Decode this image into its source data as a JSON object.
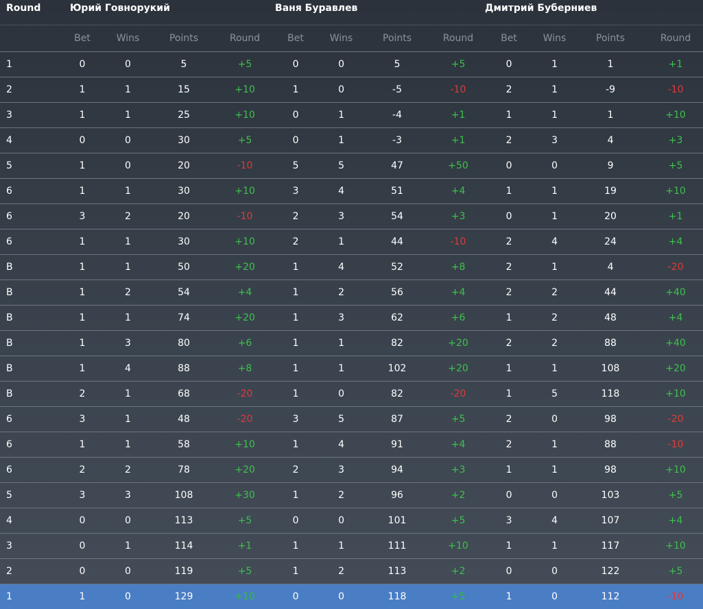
{
  "header": {
    "round_label": "Round",
    "players": [
      "Юрий Говнорукий",
      "Ваня Буравлев",
      "Дмитрий Буберниев"
    ],
    "subcolumns": [
      "Bet",
      "Wins",
      "Points",
      "Round"
    ]
  },
  "rows": [
    {
      "r": "1",
      "c": [
        [
          "0",
          "0",
          "5",
          "+5"
        ],
        [
          "0",
          "0",
          "5",
          "+5"
        ],
        [
          "0",
          "1",
          "1",
          "+1"
        ]
      ]
    },
    {
      "r": "2",
      "c": [
        [
          "1",
          "1",
          "15",
          "+10"
        ],
        [
          "1",
          "0",
          "-5",
          "-10"
        ],
        [
          "2",
          "1",
          "-9",
          "-10"
        ]
      ]
    },
    {
      "r": "3",
      "c": [
        [
          "1",
          "1",
          "25",
          "+10"
        ],
        [
          "0",
          "1",
          "-4",
          "+1"
        ],
        [
          "1",
          "1",
          "1",
          "+10"
        ]
      ]
    },
    {
      "r": "4",
      "c": [
        [
          "0",
          "0",
          "30",
          "+5"
        ],
        [
          "0",
          "1",
          "-3",
          "+1"
        ],
        [
          "2",
          "3",
          "4",
          "+3"
        ]
      ]
    },
    {
      "r": "5",
      "c": [
        [
          "1",
          "0",
          "20",
          "-10"
        ],
        [
          "5",
          "5",
          "47",
          "+50"
        ],
        [
          "0",
          "0",
          "9",
          "+5"
        ]
      ]
    },
    {
      "r": "6",
      "c": [
        [
          "1",
          "1",
          "30",
          "+10"
        ],
        [
          "3",
          "4",
          "51",
          "+4"
        ],
        [
          "1",
          "1",
          "19",
          "+10"
        ]
      ]
    },
    {
      "r": "6",
      "c": [
        [
          "3",
          "2",
          "20",
          "-10"
        ],
        [
          "2",
          "3",
          "54",
          "+3"
        ],
        [
          "0",
          "1",
          "20",
          "+1"
        ]
      ]
    },
    {
      "r": "6",
      "c": [
        [
          "1",
          "1",
          "30",
          "+10"
        ],
        [
          "2",
          "1",
          "44",
          "-10"
        ],
        [
          "2",
          "4",
          "24",
          "+4"
        ]
      ]
    },
    {
      "r": "B",
      "c": [
        [
          "1",
          "1",
          "50",
          "+20"
        ],
        [
          "1",
          "4",
          "52",
          "+8"
        ],
        [
          "2",
          "1",
          "4",
          "-20"
        ]
      ]
    },
    {
      "r": "B",
      "c": [
        [
          "1",
          "2",
          "54",
          "+4"
        ],
        [
          "1",
          "2",
          "56",
          "+4"
        ],
        [
          "2",
          "2",
          "44",
          "+40"
        ]
      ]
    },
    {
      "r": "B",
      "c": [
        [
          "1",
          "1",
          "74",
          "+20"
        ],
        [
          "1",
          "3",
          "62",
          "+6"
        ],
        [
          "1",
          "2",
          "48",
          "+4"
        ]
      ]
    },
    {
      "r": "B",
      "c": [
        [
          "1",
          "3",
          "80",
          "+6"
        ],
        [
          "1",
          "1",
          "82",
          "+20"
        ],
        [
          "2",
          "2",
          "88",
          "+40"
        ]
      ]
    },
    {
      "r": "B",
      "c": [
        [
          "1",
          "4",
          "88",
          "+8"
        ],
        [
          "1",
          "1",
          "102",
          "+20"
        ],
        [
          "1",
          "1",
          "108",
          "+20"
        ]
      ]
    },
    {
      "r": "B",
      "c": [
        [
          "2",
          "1",
          "68",
          "-20"
        ],
        [
          "1",
          "0",
          "82",
          "-20"
        ],
        [
          "1",
          "5",
          "118",
          "+10"
        ]
      ]
    },
    {
      "r": "6",
      "c": [
        [
          "3",
          "1",
          "48",
          "-20"
        ],
        [
          "3",
          "5",
          "87",
          "+5"
        ],
        [
          "2",
          "0",
          "98",
          "-20"
        ]
      ]
    },
    {
      "r": "6",
      "c": [
        [
          "1",
          "1",
          "58",
          "+10"
        ],
        [
          "1",
          "4",
          "91",
          "+4"
        ],
        [
          "2",
          "1",
          "88",
          "-10"
        ]
      ]
    },
    {
      "r": "6",
      "c": [
        [
          "2",
          "2",
          "78",
          "+20"
        ],
        [
          "2",
          "3",
          "94",
          "+3"
        ],
        [
          "1",
          "1",
          "98",
          "+10"
        ]
      ]
    },
    {
      "r": "5",
      "c": [
        [
          "3",
          "3",
          "108",
          "+30"
        ],
        [
          "1",
          "2",
          "96",
          "+2"
        ],
        [
          "0",
          "0",
          "103",
          "+5"
        ]
      ]
    },
    {
      "r": "4",
      "c": [
        [
          "0",
          "0",
          "113",
          "+5"
        ],
        [
          "0",
          "0",
          "101",
          "+5"
        ],
        [
          "3",
          "4",
          "107",
          "+4"
        ]
      ]
    },
    {
      "r": "3",
      "c": [
        [
          "0",
          "1",
          "114",
          "+1"
        ],
        [
          "1",
          "1",
          "111",
          "+10"
        ],
        [
          "1",
          "1",
          "117",
          "+10"
        ]
      ]
    },
    {
      "r": "2",
      "c": [
        [
          "0",
          "0",
          "119",
          "+5"
        ],
        [
          "1",
          "2",
          "113",
          "+2"
        ],
        [
          "0",
          "0",
          "122",
          "+5"
        ]
      ]
    },
    {
      "r": "1",
      "c": [
        [
          "1",
          "0",
          "129",
          "+10"
        ],
        [
          "0",
          "0",
          "118",
          "+5"
        ],
        [
          "1",
          "0",
          "112",
          "-10"
        ]
      ]
    }
  ],
  "active_row_index": 21,
  "colors": {
    "positive": "#3fc04e",
    "negative": "#e03a3a",
    "active_row": "#4a7ec4"
  }
}
